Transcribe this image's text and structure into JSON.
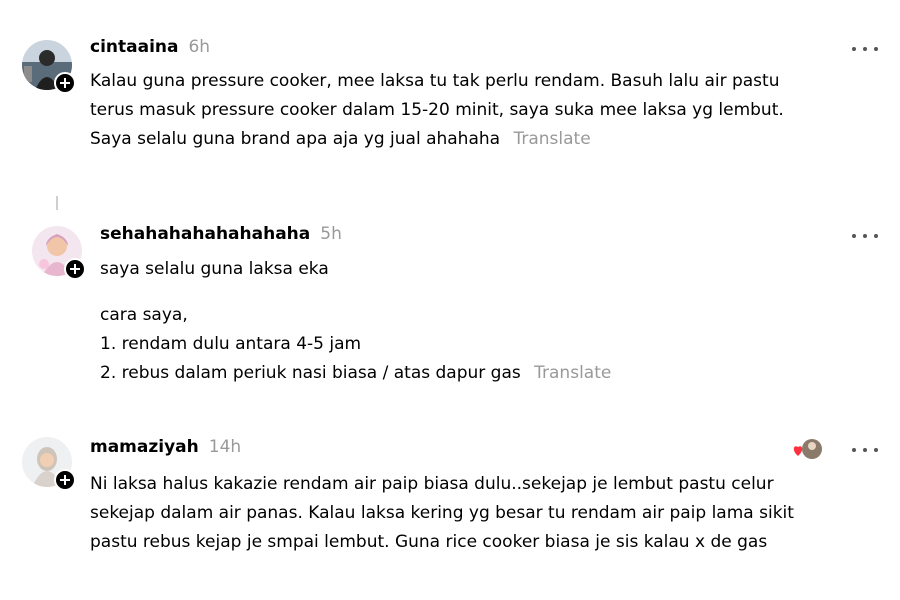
{
  "posts": [
    {
      "username": "cintaaina",
      "time": "6h",
      "lines": [
        "Kalau guna pressure cooker, mee laksa tu tak perlu rendam. Basuh lalu air pastu",
        "terus masuk pressure cooker dalam 15-20 minit, saya suka mee laksa yg lembut.",
        "Saya selalu guna brand apa aja yg jual ahahaha"
      ],
      "translate": "Translate"
    },
    {
      "username": "sehahahahahahahaha",
      "time": "5h",
      "lines": [
        "saya selalu guna laksa eka",
        "cara saya,",
        "1. rendam dulu antara 4-5 jam",
        "2. rebus dalam periuk nasi biasa / atas dapur gas"
      ],
      "translate": "Translate"
    },
    {
      "username": "mamaziyah",
      "time": "14h",
      "lines": [
        "Ni laksa halus kakazie rendam air paip biasa dulu..sekejap je lembut pastu celur",
        "sekejap dalam air panas. Kalau laksa kering yg besar tu rendam air paip lama sikit",
        "pastu rebus kejap je smpai lembut. Guna rice cooker biasa je sis kalau x de gas"
      ]
    }
  ],
  "colors": {
    "text": "#000000",
    "muted": "#999999",
    "heart": "#ff3040"
  },
  "icons": {
    "more": "more-options-icon",
    "follow": "follow-plus-icon",
    "like": "heart-icon"
  }
}
